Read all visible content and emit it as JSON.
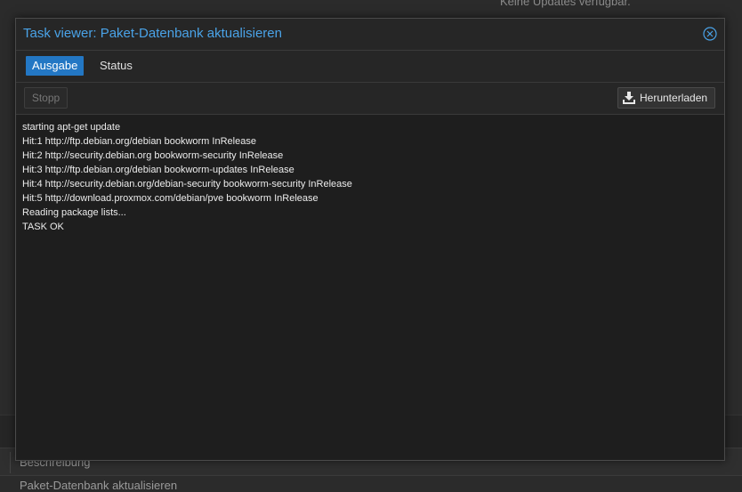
{
  "background": {
    "status_text": "Keine Updates verfügbar.",
    "grid_column_header": "Beschreibung",
    "grid_row_text": "Paket-Datenbank aktualisieren"
  },
  "modal": {
    "title": "Task viewer: Paket-Datenbank aktualisieren",
    "close_icon": "close-circle-icon",
    "tabs": [
      {
        "label": "Ausgabe",
        "active": true
      },
      {
        "label": "Status",
        "active": false
      }
    ],
    "toolbar": {
      "stop_label": "Stopp",
      "download_label": "Herunterladen",
      "download_icon": "download-icon"
    },
    "log_lines": [
      "starting apt-get update",
      "Hit:1 http://ftp.debian.org/debian bookworm InRelease",
      "Hit:2 http://security.debian.org bookworm-security InRelease",
      "Hit:3 http://ftp.debian.org/debian bookworm-updates InRelease",
      "Hit:4 http://security.debian.org/debian-security bookworm-security InRelease",
      "Hit:5 http://download.proxmox.com/debian/pve bookworm InRelease",
      "Reading package lists...",
      "TASK OK"
    ]
  },
  "colors": {
    "accent": "#2377c4",
    "title": "#4aa3e8",
    "background": "#1f1f1f"
  }
}
